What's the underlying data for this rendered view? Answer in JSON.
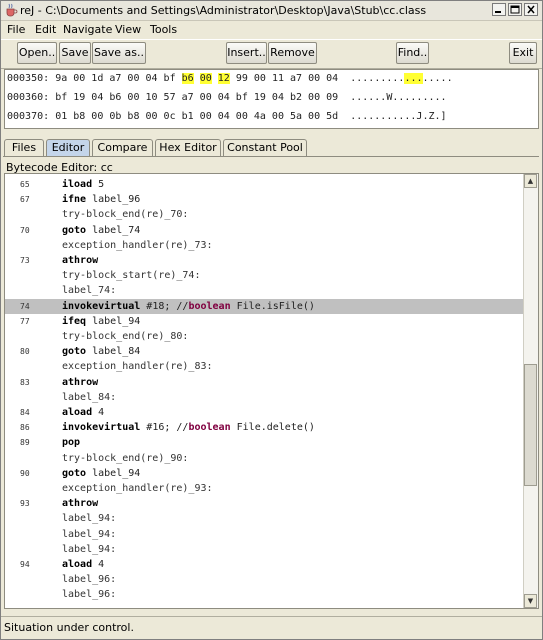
{
  "window": {
    "title": "reJ - C:\\Documents and Settings\\Administrator\\Desktop\\Java\\Stub\\cc.class",
    "app_icon": "java-cup-icon",
    "controls": [
      "minimize-icon",
      "maximize-icon",
      "close-icon"
    ]
  },
  "menu": [
    "File",
    "Edit",
    "Navigate",
    "View",
    "Tools"
  ],
  "toolbar": {
    "open": "Open..",
    "save": "Save",
    "save_as": "Save as..",
    "insert": "Insert..",
    "remove": "Remove",
    "find": "Find..",
    "exit": "Exit"
  },
  "hex": {
    "lines": [
      {
        "addr": "000350:",
        "bytes_a": "9a 00 1d a7 00 04 bf ",
        "hl1": "b6",
        "gap1": " ",
        "hl2": "00",
        "gap2": " ",
        "hl3": "12",
        "bytes_b": " 99 00 11 a7 00 04 ",
        "ascii_a": ".........",
        "ascii_hl": "...",
        "ascii_b": "....."
      },
      {
        "addr": "000360:",
        "bytes": "bf 19 04 b6 00 10 57 a7 00 04 bf 19 04 b2 00 09",
        "ascii": "......W........."
      },
      {
        "addr": "000370:",
        "bytes": "01 b8 00 0b b8 00 0c b1 00 04 00 4a 00 5a 00 5d",
        "ascii": "...........J.Z.]"
      }
    ]
  },
  "tabs": [
    "Files",
    "Editor",
    "Compare",
    "Hex Editor",
    "Constant Pool"
  ],
  "active_tab": "Editor",
  "editor_label": "Bytecode Editor: cc",
  "code": [
    {
      "num": "65",
      "op": "iload",
      "rest": " 5"
    },
    {
      "num": "67",
      "op": "ifne",
      "rest": " label_96"
    },
    {
      "num": "",
      "op": "",
      "rest": "try-block_end(re)_70:"
    },
    {
      "num": "70",
      "op": "goto",
      "rest": " label_74"
    },
    {
      "num": "",
      "op": "",
      "rest": "exception_handler(re)_73:"
    },
    {
      "num": "73",
      "op": "athrow",
      "rest": ""
    },
    {
      "num": "",
      "op": "",
      "rest": "try-block_start(re)_74:"
    },
    {
      "num": "",
      "op": "",
      "rest": "label_74:"
    },
    {
      "num": "74",
      "op": "invokevirtual",
      "rest": " #18; //",
      "kw": "boolean",
      "tail": " File.isFile()",
      "selected": true
    },
    {
      "num": "77",
      "op": "ifeq",
      "rest": " label_94"
    },
    {
      "num": "",
      "op": "",
      "rest": "try-block_end(re)_80:"
    },
    {
      "num": "80",
      "op": "goto",
      "rest": " label_84"
    },
    {
      "num": "",
      "op": "",
      "rest": "exception_handler(re)_83:"
    },
    {
      "num": "83",
      "op": "athrow",
      "rest": ""
    },
    {
      "num": "",
      "op": "",
      "rest": "label_84:"
    },
    {
      "num": "84",
      "op": "aload",
      "rest": " 4"
    },
    {
      "num": "86",
      "op": "invokevirtual",
      "rest": " #16; //",
      "kw": "boolean",
      "tail": " File.delete()"
    },
    {
      "num": "89",
      "op": "pop",
      "rest": ""
    },
    {
      "num": "",
      "op": "",
      "rest": "try-block_end(re)_90:"
    },
    {
      "num": "90",
      "op": "goto",
      "rest": " label_94"
    },
    {
      "num": "",
      "op": "",
      "rest": "exception_handler(re)_93:"
    },
    {
      "num": "93",
      "op": "athrow",
      "rest": ""
    },
    {
      "num": "",
      "op": "",
      "rest": "label_94:"
    },
    {
      "num": "",
      "op": "",
      "rest": "label_94:"
    },
    {
      "num": "",
      "op": "",
      "rest": "label_94:"
    },
    {
      "num": "94",
      "op": "aload",
      "rest": " 4"
    },
    {
      "num": "",
      "op": "",
      "rest": "label_96:"
    },
    {
      "num": "",
      "op": "",
      "rest": "label_96:"
    }
  ],
  "scrollbar": {
    "position": 0.62,
    "visible_fraction": 0.3
  },
  "status": "Situation under control.",
  "colors": {
    "highlight": "#ffff33",
    "selection": "#c0c0c0",
    "keyword": "#800040",
    "active_tab": "#c4d5ea"
  }
}
